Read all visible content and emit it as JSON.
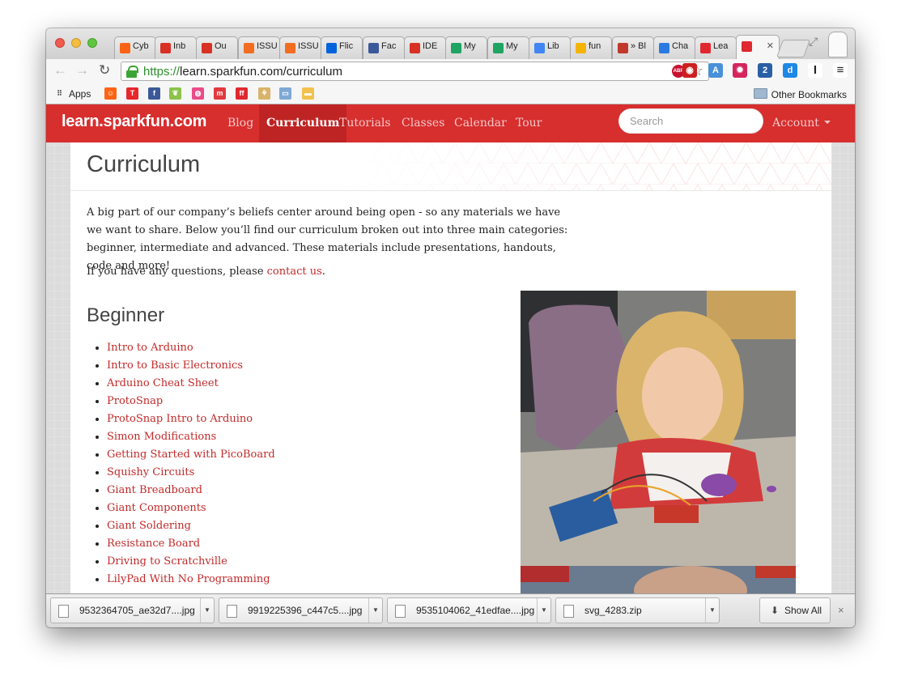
{
  "browser": {
    "tabs": [
      {
        "label": "Cyb",
        "icon": "reddit-icon",
        "color": "#ff6314"
      },
      {
        "label": "Inb",
        "icon": "gmail-icon",
        "color": "#d93025"
      },
      {
        "label": "Ou",
        "icon": "gmail-icon",
        "color": "#d93025"
      },
      {
        "label": "ISSU",
        "icon": "issuu-icon",
        "color": "#f36d21"
      },
      {
        "label": "ISSU",
        "icon": "issuu-icon",
        "color": "#f36d21"
      },
      {
        "label": "Flic",
        "icon": "flickr-icon",
        "color": "#0063dc"
      },
      {
        "label": "Fac",
        "icon": "facebook-icon",
        "color": "#3b5998"
      },
      {
        "label": "IDE",
        "icon": "gmail-icon",
        "color": "#d93025"
      },
      {
        "label": "My",
        "icon": "drive-icon",
        "color": "#1fa463"
      },
      {
        "label": "My",
        "icon": "drive-icon",
        "color": "#1fa463"
      },
      {
        "label": "Lib",
        "icon": "docs-icon",
        "color": "#4285f4"
      },
      {
        "label": "fun",
        "icon": "slides-icon",
        "color": "#f4b400"
      },
      {
        "label": "» Bl",
        "icon": "x-icon",
        "color": "#c0392b"
      },
      {
        "label": "Cha",
        "icon": "loading-icon",
        "color": "#2a7ae2"
      },
      {
        "label": "Lea",
        "icon": "sparkfun-icon",
        "color": "#e0282f"
      },
      {
        "label": "",
        "icon": "sparkfun-icon",
        "color": "#e0282f",
        "active": true
      }
    ],
    "url_scheme": "https://",
    "url_rest": "learn.sparkfun.com/curriculum",
    "abp_label": "ABP",
    "extensions": [
      {
        "icon": "stop-icon",
        "color": "#cc2020",
        "glyph": "◉"
      },
      {
        "icon": "translate-icon",
        "color": "#4a90d9",
        "glyph": "A"
      },
      {
        "icon": "splat-icon",
        "color": "#d6255d",
        "glyph": "✹"
      },
      {
        "icon": "ghostery-icon",
        "color": "#2b5fa5",
        "glyph": "2"
      },
      {
        "icon": "d-icon",
        "color": "#1e88e5",
        "glyph": "d"
      },
      {
        "icon": "instapaper-icon",
        "color": "#ffffff",
        "glyph": "I"
      },
      {
        "icon": "menu-icon",
        "color": "#ffffff",
        "glyph": "≡"
      }
    ],
    "bookmarks_apps_label": "Apps",
    "bookmarks_other_label": "Other Bookmarks",
    "bookmark_icons": [
      {
        "icon": "reddit-icon",
        "color": "#ff6314",
        "glyph": "☺"
      },
      {
        "icon": "t-icon",
        "color": "#e8262b",
        "glyph": "T"
      },
      {
        "icon": "facebook-icon",
        "color": "#3b5998",
        "glyph": "f"
      },
      {
        "icon": "leaf-icon",
        "color": "#8bc34a",
        "glyph": "❦"
      },
      {
        "icon": "dribbble-icon",
        "color": "#ea4c89",
        "glyph": "◍"
      },
      {
        "icon": "meetup-icon",
        "color": "#e0393e",
        "glyph": "m"
      },
      {
        "icon": "ffffound-icon",
        "color": "#e0282f",
        "glyph": "ff"
      },
      {
        "icon": "wheat-icon",
        "color": "#d9b36a",
        "glyph": "⚘"
      },
      {
        "icon": "folder-icon",
        "color": "#7ea8d6",
        "glyph": "▭"
      },
      {
        "icon": "box-icon",
        "color": "#f2c14e",
        "glyph": "▬"
      }
    ]
  },
  "site": {
    "brand": "learn.sparkfun.com",
    "nav": [
      "Blog",
      "Curriculum",
      "Tutorials",
      "Classes",
      "Calendar",
      "Tour"
    ],
    "active_nav": "Curriculum",
    "search_placeholder": "Search",
    "account": "Account"
  },
  "page": {
    "title": "Curriculum",
    "intro": "A big part of our company’s beliefs center around being open - so any materials we have we want to share. Below you’ll find our curriculum broken out into three main categories: beginner, intermediate and advanced. These materials include presentations, handouts, code and more!",
    "questions_prefix": "If you have any questions, please ",
    "questions_link": "contact us",
    "questions_suffix": ".",
    "section": "Beginner",
    "links": [
      "Intro to Arduino",
      "Intro to Basic Electronics",
      "Arduino Cheat Sheet",
      "ProtoSnap",
      "ProtoSnap Intro to Arduino",
      "Simon Modifications",
      "Getting Started with PicoBoard",
      "Squishy Circuits",
      "Giant Breadboard",
      "Giant Components",
      "Giant Soldering",
      "Resistance Board",
      "Driving to Scratchville",
      "LilyPad With No Programming"
    ]
  },
  "downloads": {
    "items": [
      "9532364705_ae32d7....jpg",
      "9919225396_c447c5....jpg",
      "9535104062_41edfae....jpg",
      "svg_4283.zip"
    ],
    "show_all": "Show All",
    "close": "×"
  }
}
